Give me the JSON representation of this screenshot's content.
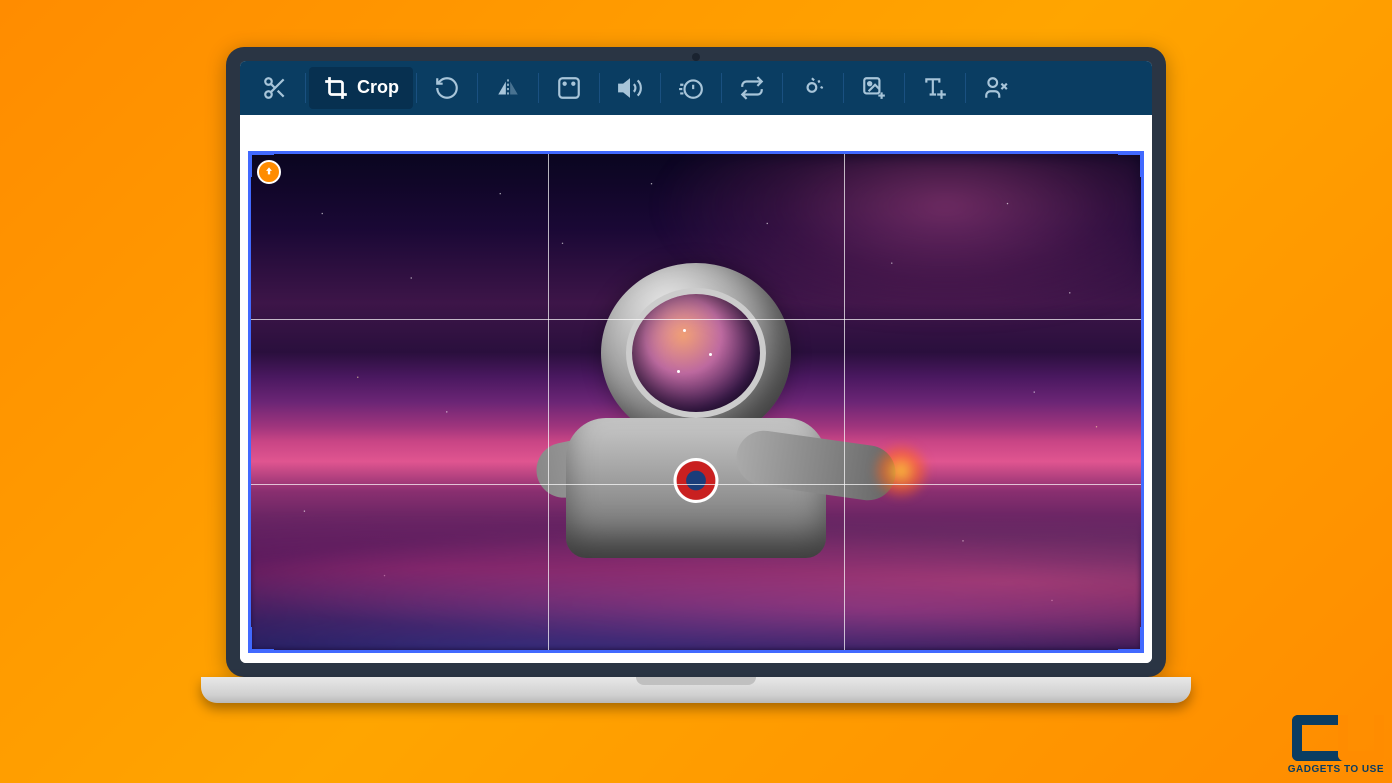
{
  "toolbar": {
    "active_tool_label": "Crop",
    "tools": [
      {
        "name": "cut",
        "icon": "scissors-icon"
      },
      {
        "name": "crop",
        "icon": "crop-icon",
        "active": true
      },
      {
        "name": "undo",
        "icon": "undo-icon"
      },
      {
        "name": "flip",
        "icon": "flip-icon"
      },
      {
        "name": "aspect",
        "icon": "aspect-icon"
      },
      {
        "name": "volume",
        "icon": "volume-icon"
      },
      {
        "name": "speed",
        "icon": "speed-icon"
      },
      {
        "name": "rotate",
        "icon": "rotate-icon"
      },
      {
        "name": "wave",
        "icon": "wave-icon"
      },
      {
        "name": "image-add",
        "icon": "image-add-icon"
      },
      {
        "name": "text-add",
        "icon": "text-add-icon"
      },
      {
        "name": "person-remove",
        "icon": "person-remove-icon"
      }
    ]
  },
  "canvas": {
    "upload_badge": "cloud-upload",
    "crop_grid": {
      "rows": 3,
      "cols": 3
    }
  },
  "watermark": {
    "brand": "GADGETS TO USE",
    "logo": "GU"
  },
  "colors": {
    "toolbar_bg": "#0a3d62",
    "crop_border": "#4169ff",
    "accent_orange": "#ff8c00"
  }
}
